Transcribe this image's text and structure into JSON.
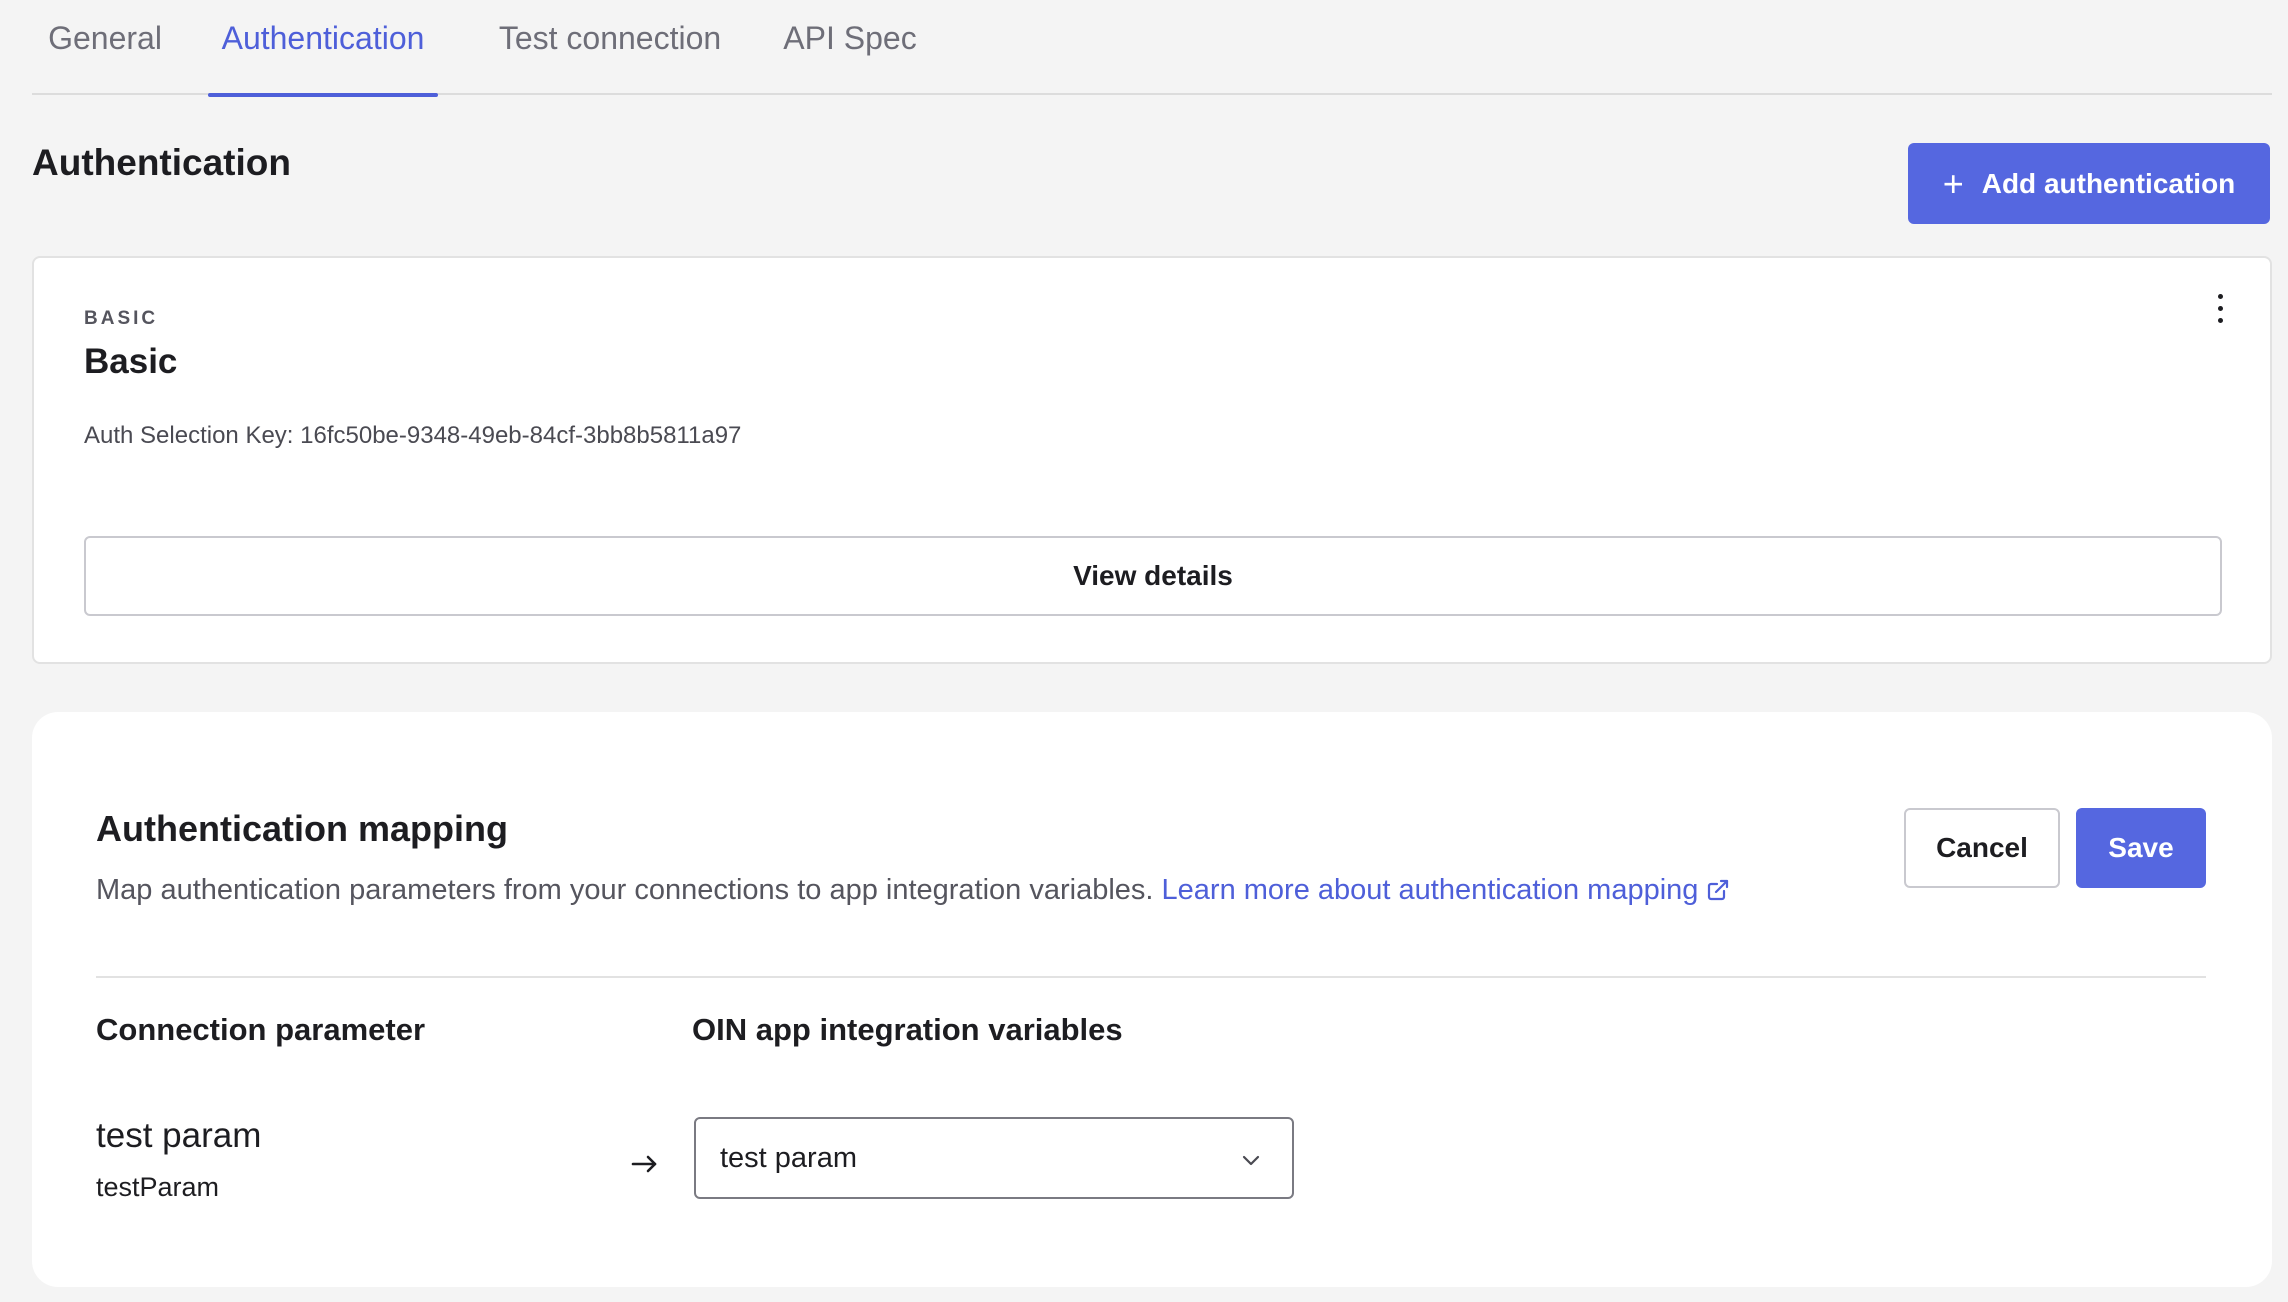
{
  "tabs": [
    {
      "label": "General",
      "active": false
    },
    {
      "label": "Authentication",
      "active": true
    },
    {
      "label": "Test connection",
      "active": false
    },
    {
      "label": "API Spec",
      "active": false
    }
  ],
  "section": {
    "title": "Authentication",
    "add_button_label": "Add authentication",
    "add_button_icon": "plus-icon"
  },
  "auth_card": {
    "type_label": "BASIC",
    "name": "Basic",
    "selection_key": "Auth Selection Key: 16fc50be-9348-49eb-84cf-3bb8b5811a97",
    "menu_icon": "more-vertical-icon",
    "view_details_label": "View details"
  },
  "mapping": {
    "title": "Authentication mapping",
    "description": "Map authentication parameters from your connections to app integration variables.",
    "learn_more_label": "Learn more about authentication mapping",
    "learn_more_icon": "external-link-icon",
    "cancel_label": "Cancel",
    "save_label": "Save",
    "col_connection_header": "Connection parameter",
    "col_variables_header": "OIN app integration variables",
    "rows": [
      {
        "param_label": "test param",
        "param_key": "testParam",
        "arrow_icon": "arrow-right-icon",
        "selected_value": "test param",
        "dropdown_icon": "chevron-down-icon"
      }
    ]
  },
  "colors": {
    "accent": "#5567e0",
    "link": "#4e5fd9",
    "background": "#f4f4f4",
    "card": "#ffffff"
  }
}
